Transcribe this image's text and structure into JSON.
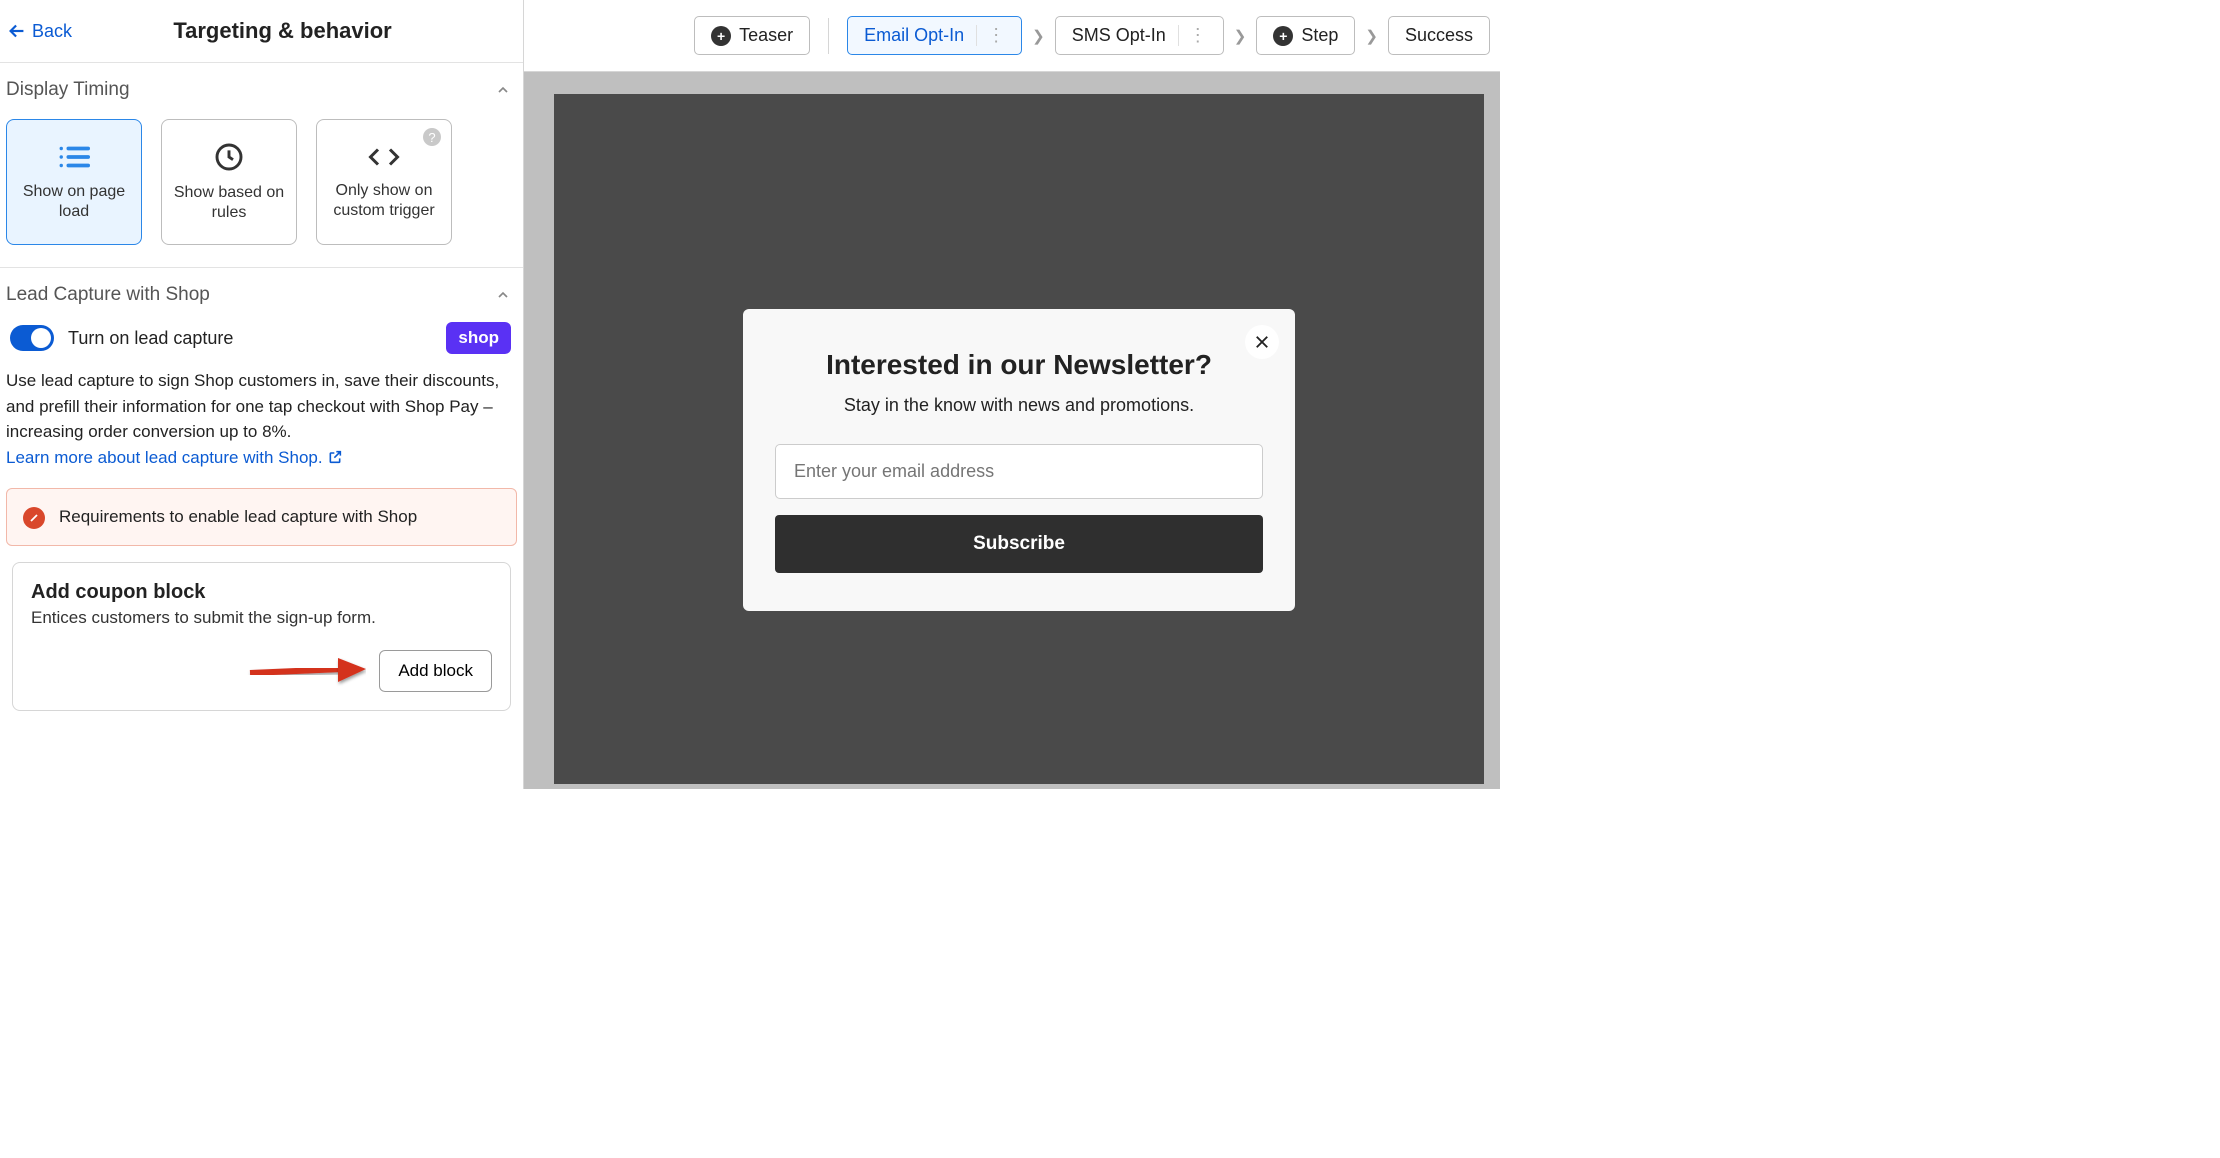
{
  "header": {
    "back_label": "Back",
    "title": "Targeting & behavior"
  },
  "sections": {
    "display_timing": {
      "title": "Display Timing",
      "options": [
        {
          "label": "Show on page load"
        },
        {
          "label": "Show based on rules"
        },
        {
          "label": "Only show on custom trigger"
        }
      ]
    },
    "lead_capture": {
      "title": "Lead Capture with Shop",
      "toggle_label": "Turn on lead capture",
      "toggle_on": true,
      "badge": "shop",
      "description": "Use lead capture to sign Shop customers in, save their discounts, and prefill their information for one tap checkout with Shop Pay – increasing order conversion up to 8%.",
      "learn_more": "Learn more about lead capture with Shop.",
      "alert": "Requirements to enable lead capture with Shop"
    },
    "coupon": {
      "title": "Add coupon block",
      "description": "Entices customers to submit the sign-up form.",
      "button": "Add block"
    }
  },
  "stepper": {
    "teaser": "Teaser",
    "email": "Email Opt-In",
    "sms": "SMS Opt-In",
    "step": "Step",
    "success": "Success"
  },
  "popup": {
    "title": "Interested in our Newsletter?",
    "subtitle": "Stay in the know with news and promotions.",
    "placeholder": "Enter your email address",
    "button": "Subscribe"
  }
}
